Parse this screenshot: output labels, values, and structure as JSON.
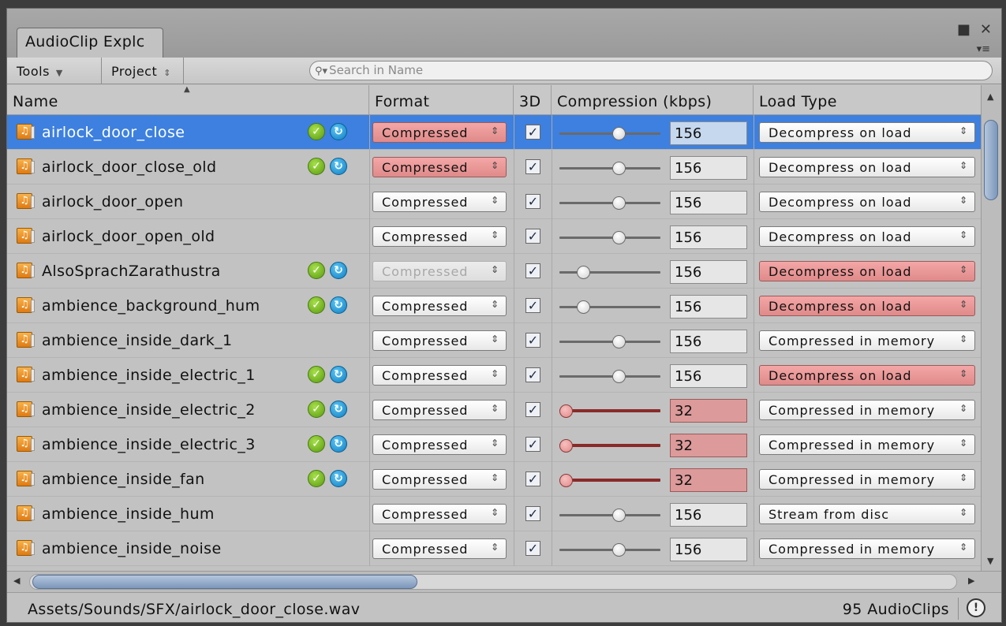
{
  "window": {
    "tab_title": "AudioClip Explc",
    "maximize_icon": "maximize-icon",
    "close_icon": "close-icon",
    "menu_icon": "menu-icon"
  },
  "toolbar": {
    "tools_label": "Tools",
    "project_label": "Project",
    "search_placeholder": "Search in Name"
  },
  "columns": {
    "name": "Name",
    "format": "Format",
    "three_d": "3D",
    "compression": "Compression (kbps)",
    "load_type": "Load Type"
  },
  "rows": [
    {
      "name": "airlock_door_close",
      "icons": true,
      "format": "Compressed",
      "format_state": "red",
      "three_d": true,
      "compression": "156",
      "slider": 0.6,
      "slider_state": "normal",
      "load_type": "Decompress on load",
      "load_state": "normal",
      "selected": true
    },
    {
      "name": "airlock_door_close_old",
      "icons": true,
      "format": "Compressed",
      "format_state": "red",
      "three_d": true,
      "compression": "156",
      "slider": 0.6,
      "slider_state": "normal",
      "load_type": "Decompress on load",
      "load_state": "normal",
      "selected": false
    },
    {
      "name": "airlock_door_open",
      "icons": false,
      "format": "Compressed",
      "format_state": "normal",
      "three_d": true,
      "compression": "156",
      "slider": 0.6,
      "slider_state": "normal",
      "load_type": "Decompress on load",
      "load_state": "normal",
      "selected": false
    },
    {
      "name": "airlock_door_open_old",
      "icons": false,
      "format": "Compressed",
      "format_state": "normal",
      "three_d": true,
      "compression": "156",
      "slider": 0.6,
      "slider_state": "normal",
      "load_type": "Decompress on load",
      "load_state": "normal",
      "selected": false
    },
    {
      "name": "AlsoSprachZarathustra",
      "icons": true,
      "format": "Compressed",
      "format_state": "disabled",
      "three_d": true,
      "compression": "156",
      "slider": 0.2,
      "slider_state": "normal",
      "load_type": "Decompress on load",
      "load_state": "red",
      "selected": false
    },
    {
      "name": "ambience_background_hum",
      "icons": true,
      "format": "Compressed",
      "format_state": "normal",
      "three_d": true,
      "compression": "156",
      "slider": 0.2,
      "slider_state": "normal",
      "load_type": "Decompress on load",
      "load_state": "red",
      "selected": false
    },
    {
      "name": "ambience_inside_dark_1",
      "icons": false,
      "format": "Compressed",
      "format_state": "normal",
      "three_d": true,
      "compression": "156",
      "slider": 0.6,
      "slider_state": "normal",
      "load_type": "Compressed in memory",
      "load_state": "normal",
      "selected": false
    },
    {
      "name": "ambience_inside_electric_1",
      "icons": true,
      "format": "Compressed",
      "format_state": "normal",
      "three_d": true,
      "compression": "156",
      "slider": 0.6,
      "slider_state": "normal",
      "load_type": "Decompress on load",
      "load_state": "red",
      "selected": false
    },
    {
      "name": "ambience_inside_electric_2",
      "icons": true,
      "format": "Compressed",
      "format_state": "normal",
      "three_d": true,
      "compression": "32",
      "slider": 0.0,
      "slider_state": "red",
      "load_type": "Compressed in memory",
      "load_state": "normal",
      "selected": false
    },
    {
      "name": "ambience_inside_electric_3",
      "icons": true,
      "format": "Compressed",
      "format_state": "normal",
      "three_d": true,
      "compression": "32",
      "slider": 0.0,
      "slider_state": "red",
      "load_type": "Compressed in memory",
      "load_state": "normal",
      "selected": false
    },
    {
      "name": "ambience_inside_fan",
      "icons": true,
      "format": "Compressed",
      "format_state": "normal",
      "three_d": true,
      "compression": "32",
      "slider": 0.0,
      "slider_state": "red",
      "load_type": "Compressed in memory",
      "load_state": "normal",
      "selected": false
    },
    {
      "name": "ambience_inside_hum",
      "icons": false,
      "format": "Compressed",
      "format_state": "normal",
      "three_d": true,
      "compression": "156",
      "slider": 0.6,
      "slider_state": "normal",
      "load_type": "Stream from disc",
      "load_state": "normal",
      "selected": false
    },
    {
      "name": "ambience_inside_noise",
      "icons": false,
      "format": "Compressed",
      "format_state": "normal",
      "three_d": true,
      "compression": "156",
      "slider": 0.6,
      "slider_state": "normal",
      "load_type": "Compressed in memory",
      "load_state": "normal",
      "selected": false
    }
  ],
  "status": {
    "path": "Assets/Sounds/SFX/airlock_door_close.wav",
    "count": "95 AudioClips",
    "warning_icon": "warning-icon"
  },
  "colors": {
    "selection": "#3d80df",
    "error_highlight": "#e08a8a",
    "ok_icon": "#5a9a10",
    "sync_icon": "#0f7ec2"
  }
}
